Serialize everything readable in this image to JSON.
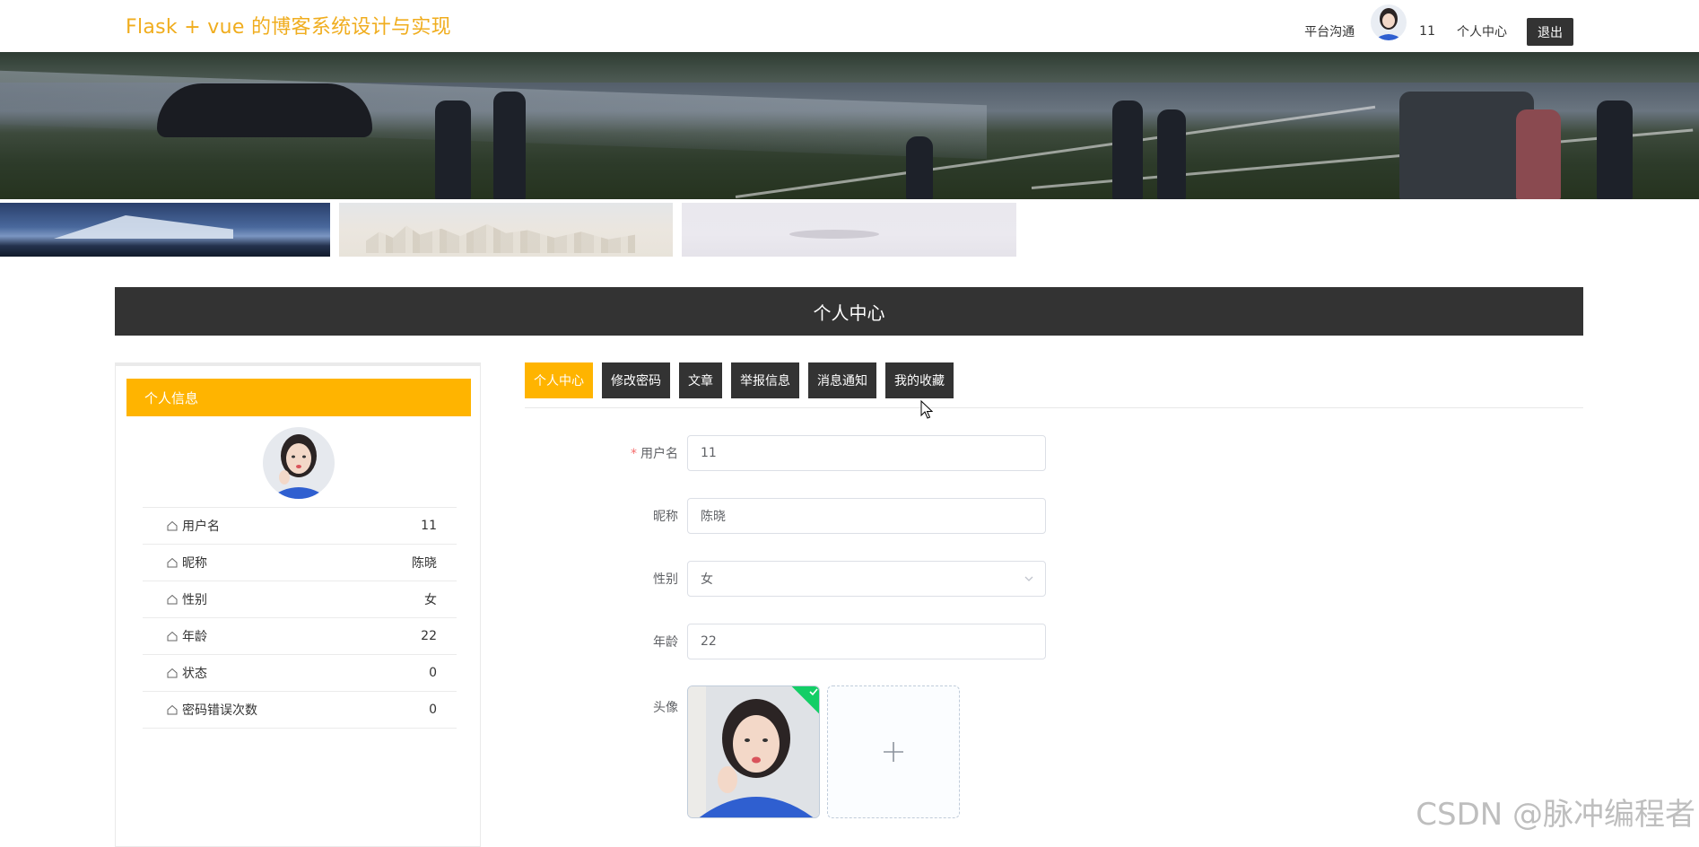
{
  "header": {
    "site_title": "Flask + vue 的博客系统设计与实现",
    "nav": {
      "chat_label": "平台沟通",
      "username": "11",
      "profile_label": "个人中心",
      "logout_label": "退出"
    }
  },
  "section_title": "个人中心",
  "sidebar": {
    "title": "个人信息",
    "rows": [
      {
        "label": "用户名",
        "value": "11"
      },
      {
        "label": "昵称",
        "value": "陈晓"
      },
      {
        "label": "性别",
        "value": "女"
      },
      {
        "label": "年龄",
        "value": "22"
      },
      {
        "label": "状态",
        "value": "0"
      },
      {
        "label": "密码错误次数",
        "value": "0"
      }
    ]
  },
  "tabs": [
    {
      "label": "个人中心",
      "active": true
    },
    {
      "label": "修改密码",
      "active": false
    },
    {
      "label": "文章",
      "active": false
    },
    {
      "label": "举报信息",
      "active": false
    },
    {
      "label": "消息通知",
      "active": false
    },
    {
      "label": "我的收藏",
      "active": false
    }
  ],
  "form": {
    "username": {
      "label": "用户名",
      "value": "11",
      "required": true
    },
    "nickname": {
      "label": "昵称",
      "value": "陈晓"
    },
    "gender": {
      "label": "性别",
      "value": "女"
    },
    "age": {
      "label": "年龄",
      "value": "22"
    },
    "avatar": {
      "label": "头像",
      "add_symbol": "+"
    }
  },
  "watermark": "CSDN @脉冲编程者",
  "colors": {
    "accent": "#ffb400",
    "title": "#f0ad1e",
    "dark": "#333333",
    "success": "#13ce66",
    "required": "#f56c6c"
  }
}
